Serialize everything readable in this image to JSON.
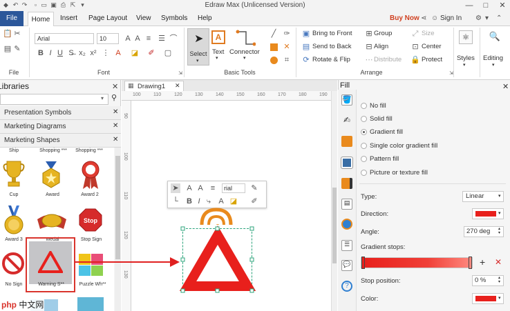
{
  "window": {
    "title": "Edraw Max (Unlicensed Version)",
    "controls": [
      "—",
      "□",
      "✕"
    ]
  },
  "menubar": {
    "items": [
      "File",
      "Home",
      "Insert",
      "Page Layout",
      "View",
      "Symbols",
      "Help"
    ],
    "buy_now": "Buy Now",
    "sign_in": "Sign In"
  },
  "ribbon": {
    "font": {
      "family": "Arial",
      "size": "10",
      "bold": "B",
      "italic": "I",
      "underline": "U"
    },
    "groups": [
      "File",
      "Font",
      "Basic Tools",
      "Arrange",
      "Styles",
      "Editing"
    ],
    "tools": {
      "select": "Select",
      "text": "Text",
      "connector": "Connector"
    },
    "arrange": {
      "bring_to_front": "Bring to Front",
      "send_to_back": "Send to Back",
      "rotate_flip": "Rotate & Flip",
      "group": "Group",
      "align": "Align",
      "distribute": "Distribute",
      "size": "Size",
      "center": "Center",
      "protect": "Protect"
    }
  },
  "library": {
    "title": "Libraries",
    "search_placeholder": "",
    "categories": [
      "Presentation Symbols",
      "Marketing Diagrams",
      "Marketing Shapes"
    ],
    "shape_rows": [
      [
        "Ship",
        "Shopping ***",
        "Shopping ***"
      ],
      [
        "Cup",
        "Award",
        "Award 2"
      ],
      [
        "Award 3",
        "Medal",
        "Stop Sign"
      ],
      [
        "No Sign",
        "Warning S**",
        "Puzzle Wh**"
      ]
    ]
  },
  "canvas": {
    "tab": "Drawing1",
    "ruler_h": [
      "100",
      "110",
      "120",
      "130",
      "140",
      "150",
      "160",
      "170",
      "180",
      "190"
    ],
    "ruler_v": [
      "90",
      "100",
      "110",
      "120",
      "130"
    ],
    "mini_toolbar": {
      "font": "rial"
    }
  },
  "fill": {
    "title": "Fill",
    "options": [
      "No fill",
      "Solid fill",
      "Gradient fill",
      "Single color gradient fill",
      "Pattern fill",
      "Picture or texture fill"
    ],
    "selected_option": "Gradient fill",
    "type_label": "Type:",
    "type_value": "Linear",
    "direction_label": "Direction:",
    "angle_label": "Angle:",
    "angle_value": "270 deg",
    "gradient_stops_label": "Gradient stops:",
    "stop_position_label": "Stop position:",
    "stop_position_value": "0 %",
    "color_label": "Color:",
    "colors": {
      "gradient_start": "#e8201c",
      "gradient_end": "#ff8a80",
      "accent": "#e02020"
    }
  },
  "watermark": "中文网"
}
